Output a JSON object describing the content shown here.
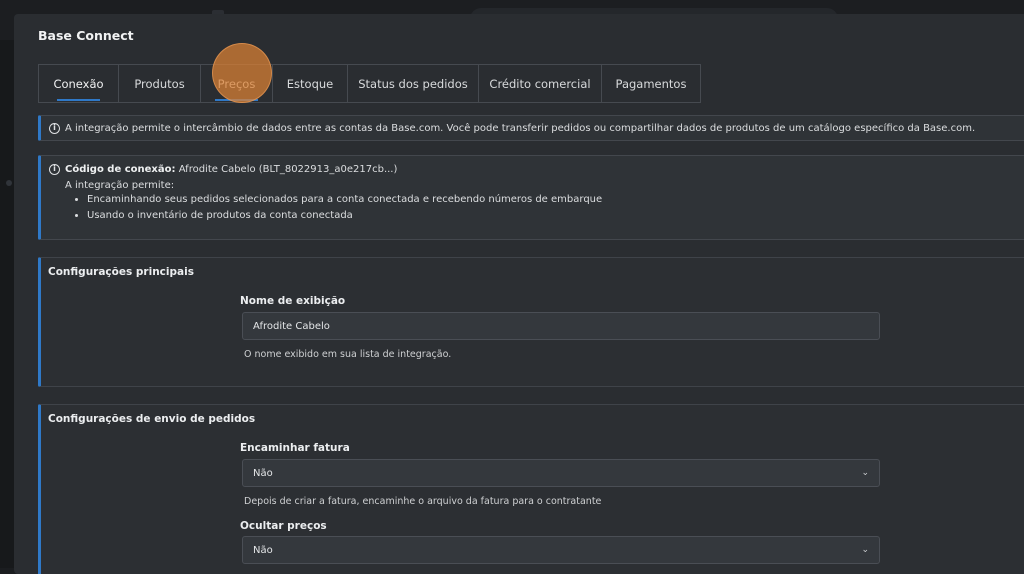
{
  "modal": {
    "title": "Base Connect"
  },
  "tabs": [
    {
      "label": "Conexão",
      "active": true
    },
    {
      "label": "Produtos",
      "active": false
    },
    {
      "label": "Preços",
      "active": false
    },
    {
      "label": "Estoque",
      "active": false
    },
    {
      "label": "Status dos pedidos",
      "active": false
    },
    {
      "label": "Crédito comercial",
      "active": false
    },
    {
      "label": "Pagamentos",
      "active": false
    }
  ],
  "info_banner": {
    "text": "A integração permite o intercâmbio de dados entre as contas da Base.com. Você pode transferir pedidos ou compartilhar dados de produtos de um catálogo específico da Base.com."
  },
  "connection_info": {
    "code_label": "Código de conexão:",
    "code_value": "Afrodite Cabelo (BLT_8022913_a0e217cb...)",
    "intro": "A integração permite:",
    "items": [
      "Encaminhando seus pedidos selecionados para a conta conectada e recebendo números de embarque",
      "Usando o inventário de produtos da conta conectada"
    ]
  },
  "main_settings": {
    "title": "Configurações principais",
    "display_name_label": "Nome de exibição",
    "display_name_value": "Afrodite Cabelo",
    "display_name_help": "O nome exibido em sua lista de integração."
  },
  "order_settings": {
    "title": "Configurações de envio de pedidos",
    "forward_invoice_label": "Encaminhar fatura",
    "forward_invoice_value": "Não",
    "forward_invoice_help": "Depois de criar a fatura, encaminhe o arquivo da fatura para o contratante",
    "hide_prices_label": "Ocultar preços",
    "hide_prices_value": "Não"
  },
  "colors": {
    "accent": "#2f79c8",
    "highlight": "#de8234",
    "modal_bg": "#2a2d31"
  }
}
